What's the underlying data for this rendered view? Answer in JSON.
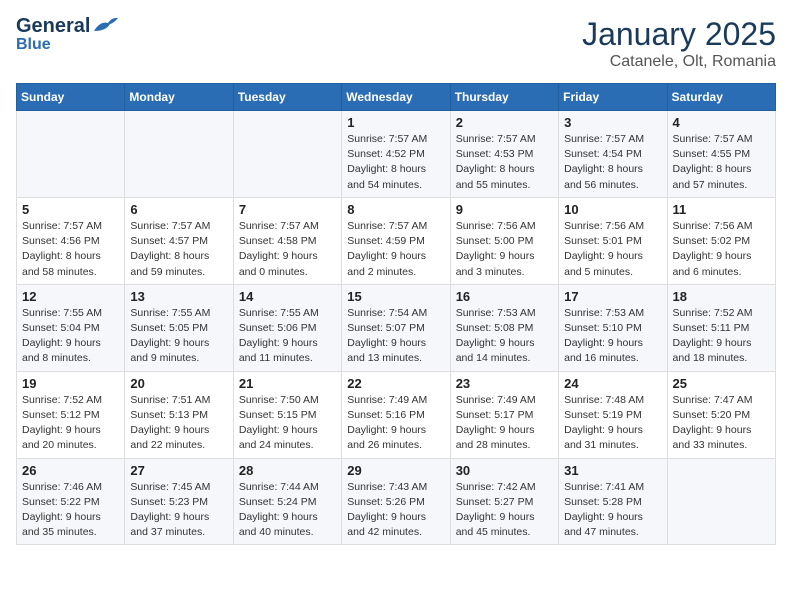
{
  "header": {
    "logo_line1": "General",
    "logo_line2": "Blue",
    "month": "January 2025",
    "location": "Catanele, Olt, Romania"
  },
  "weekdays": [
    "Sunday",
    "Monday",
    "Tuesday",
    "Wednesday",
    "Thursday",
    "Friday",
    "Saturday"
  ],
  "weeks": [
    [
      {
        "day": "",
        "sunrise": "",
        "sunset": "",
        "daylight": ""
      },
      {
        "day": "",
        "sunrise": "",
        "sunset": "",
        "daylight": ""
      },
      {
        "day": "",
        "sunrise": "",
        "sunset": "",
        "daylight": ""
      },
      {
        "day": "1",
        "sunrise": "Sunrise: 7:57 AM",
        "sunset": "Sunset: 4:52 PM",
        "daylight": "Daylight: 8 hours and 54 minutes."
      },
      {
        "day": "2",
        "sunrise": "Sunrise: 7:57 AM",
        "sunset": "Sunset: 4:53 PM",
        "daylight": "Daylight: 8 hours and 55 minutes."
      },
      {
        "day": "3",
        "sunrise": "Sunrise: 7:57 AM",
        "sunset": "Sunset: 4:54 PM",
        "daylight": "Daylight: 8 hours and 56 minutes."
      },
      {
        "day": "4",
        "sunrise": "Sunrise: 7:57 AM",
        "sunset": "Sunset: 4:55 PM",
        "daylight": "Daylight: 8 hours and 57 minutes."
      }
    ],
    [
      {
        "day": "5",
        "sunrise": "Sunrise: 7:57 AM",
        "sunset": "Sunset: 4:56 PM",
        "daylight": "Daylight: 8 hours and 58 minutes."
      },
      {
        "day": "6",
        "sunrise": "Sunrise: 7:57 AM",
        "sunset": "Sunset: 4:57 PM",
        "daylight": "Daylight: 8 hours and 59 minutes."
      },
      {
        "day": "7",
        "sunrise": "Sunrise: 7:57 AM",
        "sunset": "Sunset: 4:58 PM",
        "daylight": "Daylight: 9 hours and 0 minutes."
      },
      {
        "day": "8",
        "sunrise": "Sunrise: 7:57 AM",
        "sunset": "Sunset: 4:59 PM",
        "daylight": "Daylight: 9 hours and 2 minutes."
      },
      {
        "day": "9",
        "sunrise": "Sunrise: 7:56 AM",
        "sunset": "Sunset: 5:00 PM",
        "daylight": "Daylight: 9 hours and 3 minutes."
      },
      {
        "day": "10",
        "sunrise": "Sunrise: 7:56 AM",
        "sunset": "Sunset: 5:01 PM",
        "daylight": "Daylight: 9 hours and 5 minutes."
      },
      {
        "day": "11",
        "sunrise": "Sunrise: 7:56 AM",
        "sunset": "Sunset: 5:02 PM",
        "daylight": "Daylight: 9 hours and 6 minutes."
      }
    ],
    [
      {
        "day": "12",
        "sunrise": "Sunrise: 7:55 AM",
        "sunset": "Sunset: 5:04 PM",
        "daylight": "Daylight: 9 hours and 8 minutes."
      },
      {
        "day": "13",
        "sunrise": "Sunrise: 7:55 AM",
        "sunset": "Sunset: 5:05 PM",
        "daylight": "Daylight: 9 hours and 9 minutes."
      },
      {
        "day": "14",
        "sunrise": "Sunrise: 7:55 AM",
        "sunset": "Sunset: 5:06 PM",
        "daylight": "Daylight: 9 hours and 11 minutes."
      },
      {
        "day": "15",
        "sunrise": "Sunrise: 7:54 AM",
        "sunset": "Sunset: 5:07 PM",
        "daylight": "Daylight: 9 hours and 13 minutes."
      },
      {
        "day": "16",
        "sunrise": "Sunrise: 7:53 AM",
        "sunset": "Sunset: 5:08 PM",
        "daylight": "Daylight: 9 hours and 14 minutes."
      },
      {
        "day": "17",
        "sunrise": "Sunrise: 7:53 AM",
        "sunset": "Sunset: 5:10 PM",
        "daylight": "Daylight: 9 hours and 16 minutes."
      },
      {
        "day": "18",
        "sunrise": "Sunrise: 7:52 AM",
        "sunset": "Sunset: 5:11 PM",
        "daylight": "Daylight: 9 hours and 18 minutes."
      }
    ],
    [
      {
        "day": "19",
        "sunrise": "Sunrise: 7:52 AM",
        "sunset": "Sunset: 5:12 PM",
        "daylight": "Daylight: 9 hours and 20 minutes."
      },
      {
        "day": "20",
        "sunrise": "Sunrise: 7:51 AM",
        "sunset": "Sunset: 5:13 PM",
        "daylight": "Daylight: 9 hours and 22 minutes."
      },
      {
        "day": "21",
        "sunrise": "Sunrise: 7:50 AM",
        "sunset": "Sunset: 5:15 PM",
        "daylight": "Daylight: 9 hours and 24 minutes."
      },
      {
        "day": "22",
        "sunrise": "Sunrise: 7:49 AM",
        "sunset": "Sunset: 5:16 PM",
        "daylight": "Daylight: 9 hours and 26 minutes."
      },
      {
        "day": "23",
        "sunrise": "Sunrise: 7:49 AM",
        "sunset": "Sunset: 5:17 PM",
        "daylight": "Daylight: 9 hours and 28 minutes."
      },
      {
        "day": "24",
        "sunrise": "Sunrise: 7:48 AM",
        "sunset": "Sunset: 5:19 PM",
        "daylight": "Daylight: 9 hours and 31 minutes."
      },
      {
        "day": "25",
        "sunrise": "Sunrise: 7:47 AM",
        "sunset": "Sunset: 5:20 PM",
        "daylight": "Daylight: 9 hours and 33 minutes."
      }
    ],
    [
      {
        "day": "26",
        "sunrise": "Sunrise: 7:46 AM",
        "sunset": "Sunset: 5:22 PM",
        "daylight": "Daylight: 9 hours and 35 minutes."
      },
      {
        "day": "27",
        "sunrise": "Sunrise: 7:45 AM",
        "sunset": "Sunset: 5:23 PM",
        "daylight": "Daylight: 9 hours and 37 minutes."
      },
      {
        "day": "28",
        "sunrise": "Sunrise: 7:44 AM",
        "sunset": "Sunset: 5:24 PM",
        "daylight": "Daylight: 9 hours and 40 minutes."
      },
      {
        "day": "29",
        "sunrise": "Sunrise: 7:43 AM",
        "sunset": "Sunset: 5:26 PM",
        "daylight": "Daylight: 9 hours and 42 minutes."
      },
      {
        "day": "30",
        "sunrise": "Sunrise: 7:42 AM",
        "sunset": "Sunset: 5:27 PM",
        "daylight": "Daylight: 9 hours and 45 minutes."
      },
      {
        "day": "31",
        "sunrise": "Sunrise: 7:41 AM",
        "sunset": "Sunset: 5:28 PM",
        "daylight": "Daylight: 9 hours and 47 minutes."
      },
      {
        "day": "",
        "sunrise": "",
        "sunset": "",
        "daylight": ""
      }
    ]
  ]
}
